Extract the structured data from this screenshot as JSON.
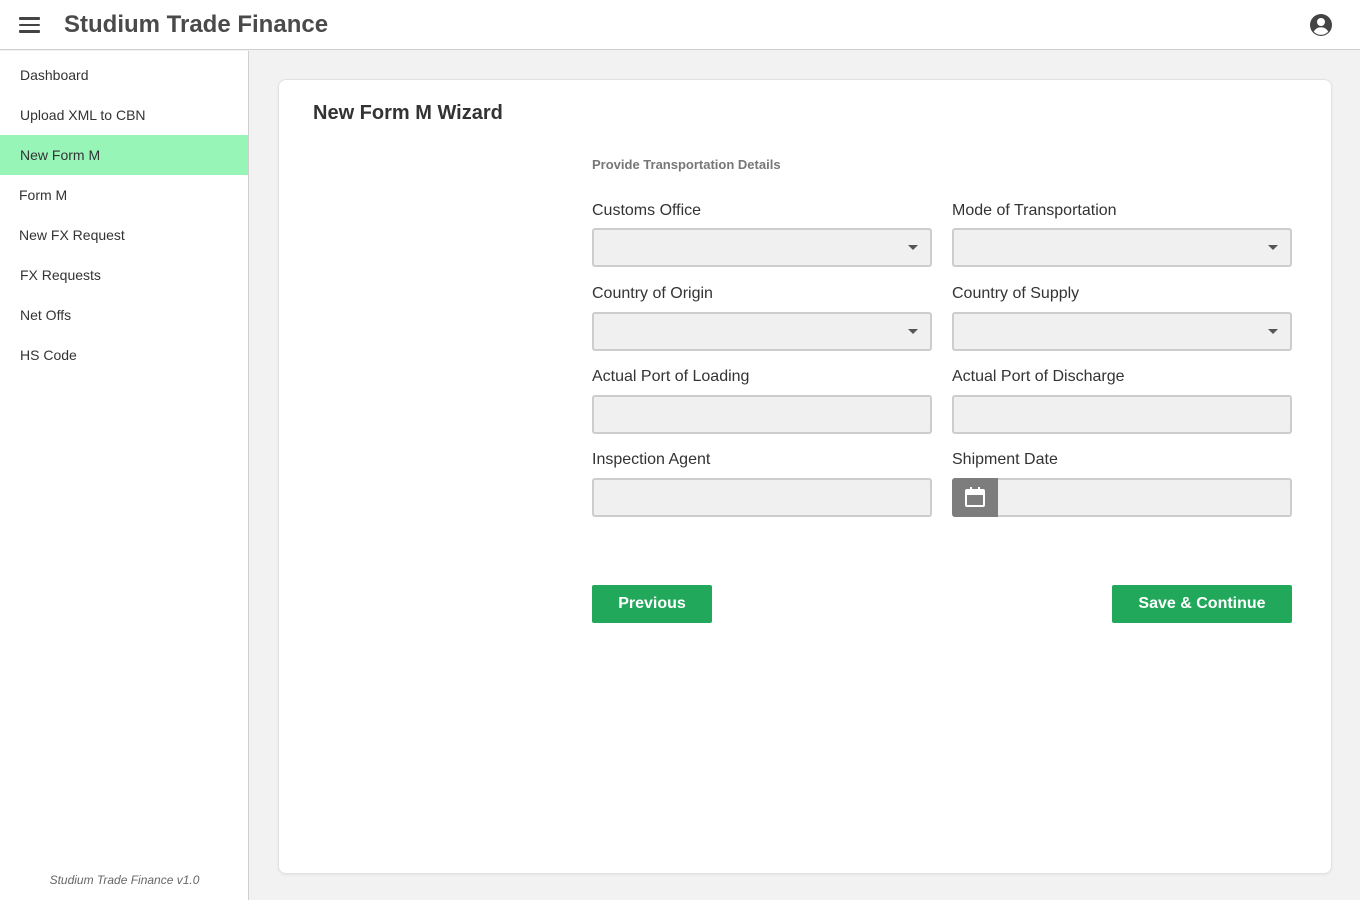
{
  "header": {
    "title": "Studium Trade Finance",
    "menu_icon": "hamburger-menu-icon",
    "account_icon": "account-circle-icon"
  },
  "sidebar": {
    "items": [
      {
        "label": "Dashboard",
        "active": false
      },
      {
        "label": "Upload XML to CBN",
        "active": false
      },
      {
        "label": "New Form M",
        "active": true
      },
      {
        "label": "Form M",
        "active": false
      },
      {
        "label": "New FX Request",
        "active": false
      },
      {
        "label": "FX Requests",
        "active": false
      },
      {
        "label": "Net Offs",
        "active": false
      },
      {
        "label": "HS Code",
        "active": false
      }
    ],
    "footer": "Studium Trade Finance v1.0",
    "active_color": "#98f5b8"
  },
  "wizard": {
    "title": "New Form M Wizard",
    "section_title": "Provide Transportation Details",
    "fields": {
      "customs_office": {
        "label": "Customs Office",
        "value": ""
      },
      "mode_of_transportation": {
        "label": "Mode of Transportation",
        "value": ""
      },
      "country_of_origin": {
        "label": "Country of Origin",
        "value": ""
      },
      "country_of_supply": {
        "label": "Country of Supply",
        "value": ""
      },
      "port_of_loading": {
        "label": "Actual Port of Loading",
        "value": ""
      },
      "port_of_discharge": {
        "label": "Actual Port of Discharge",
        "value": ""
      },
      "inspection_agent": {
        "label": "Inspection Agent",
        "value": ""
      },
      "shipment_date": {
        "label": "Shipment Date",
        "value": "",
        "icon": "calendar-icon"
      }
    },
    "buttons": {
      "previous": "Previous",
      "save_continue": "Save & Continue"
    },
    "button_color": "#22a85b"
  }
}
